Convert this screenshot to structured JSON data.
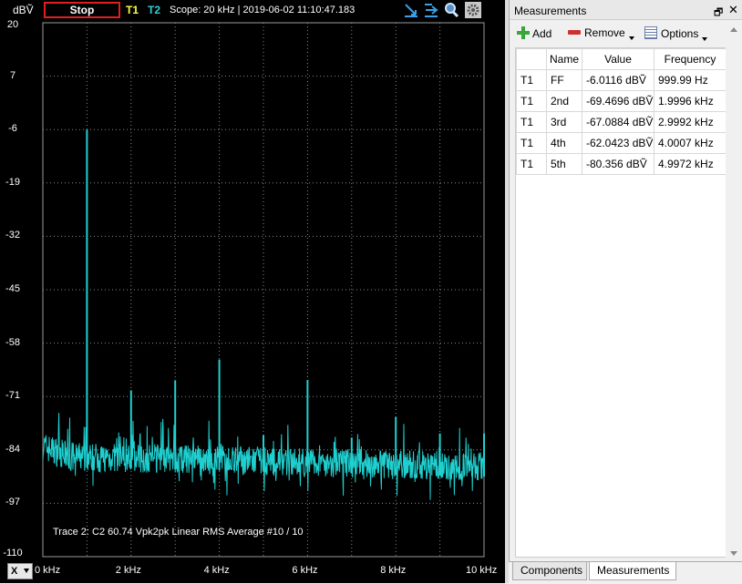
{
  "toolbar": {
    "unit": "dBṼ",
    "stop_label": "Stop",
    "t1_label": "T1",
    "t2_label": "T2",
    "info": "Scope: 20 kHz | 2019-06-02 11:10:47.183",
    "icons": [
      "autoscale-x-icon",
      "autoscale-y-icon",
      "zoom-icon",
      "settings-icon"
    ]
  },
  "chart_data": {
    "type": "line",
    "title": "",
    "xlabel": "",
    "ylabel": "dBṼ",
    "xlim": [
      0,
      10
    ],
    "ylim": [
      -110,
      20
    ],
    "y_ticks": [
      "20",
      "7",
      "-6",
      "-19",
      "-32",
      "-45",
      "-58",
      "-71",
      "-84",
      "-97",
      "-110"
    ],
    "x_ticks": [
      "0 kHz",
      "2 kHz",
      "4 kHz",
      "6 kHz",
      "8 kHz",
      "10 kHz"
    ],
    "grid": true,
    "series": [
      {
        "name": "Trace 2",
        "color": "#20d0d0",
        "noise_floor_dBV": -89,
        "peaks": [
          {
            "x": 1.0,
            "y": -6.0
          },
          {
            "x": 2.0,
            "y": -69.5
          },
          {
            "x": 3.0,
            "y": -67.1
          },
          {
            "x": 4.0,
            "y": -62.0
          },
          {
            "x": 5.0,
            "y": -80.4
          },
          {
            "x": 6.0,
            "y": -67.0
          },
          {
            "x": 7.0,
            "y": -81.0
          },
          {
            "x": 8.0,
            "y": -76.0
          },
          {
            "x": 9.0,
            "y": -80.0
          },
          {
            "x": 10.0,
            "y": -80.0
          }
        ]
      }
    ],
    "annotation": "Trace 2: C2 60.74 Vpk2pk Linear RMS Average #10 / 10"
  },
  "x_axis_button": "X",
  "measurements": {
    "title": "Measurements",
    "add_label": "Add",
    "remove_label": "Remove",
    "options_label": "Options",
    "columns": [
      "",
      "Name",
      "Value",
      "Frequency"
    ],
    "rows": [
      {
        "trace": "T1",
        "name": "FF",
        "value": "-6.0116 dBṼ",
        "freq": "999.99 Hz"
      },
      {
        "trace": "T1",
        "name": "2nd",
        "value": "-69.4696 dBṼ",
        "freq": "1.9996 kHz"
      },
      {
        "trace": "T1",
        "name": "3rd",
        "value": "-67.0884 dBṼ",
        "freq": "2.9992 kHz"
      },
      {
        "trace": "T1",
        "name": "4th",
        "value": "-62.0423 dBṼ",
        "freq": "4.0007 kHz"
      },
      {
        "trace": "T1",
        "name": "5th",
        "value": "-80.356 dBṼ",
        "freq": "4.9972 kHz"
      }
    ]
  },
  "tabs": [
    "Components",
    "Measurements"
  ]
}
